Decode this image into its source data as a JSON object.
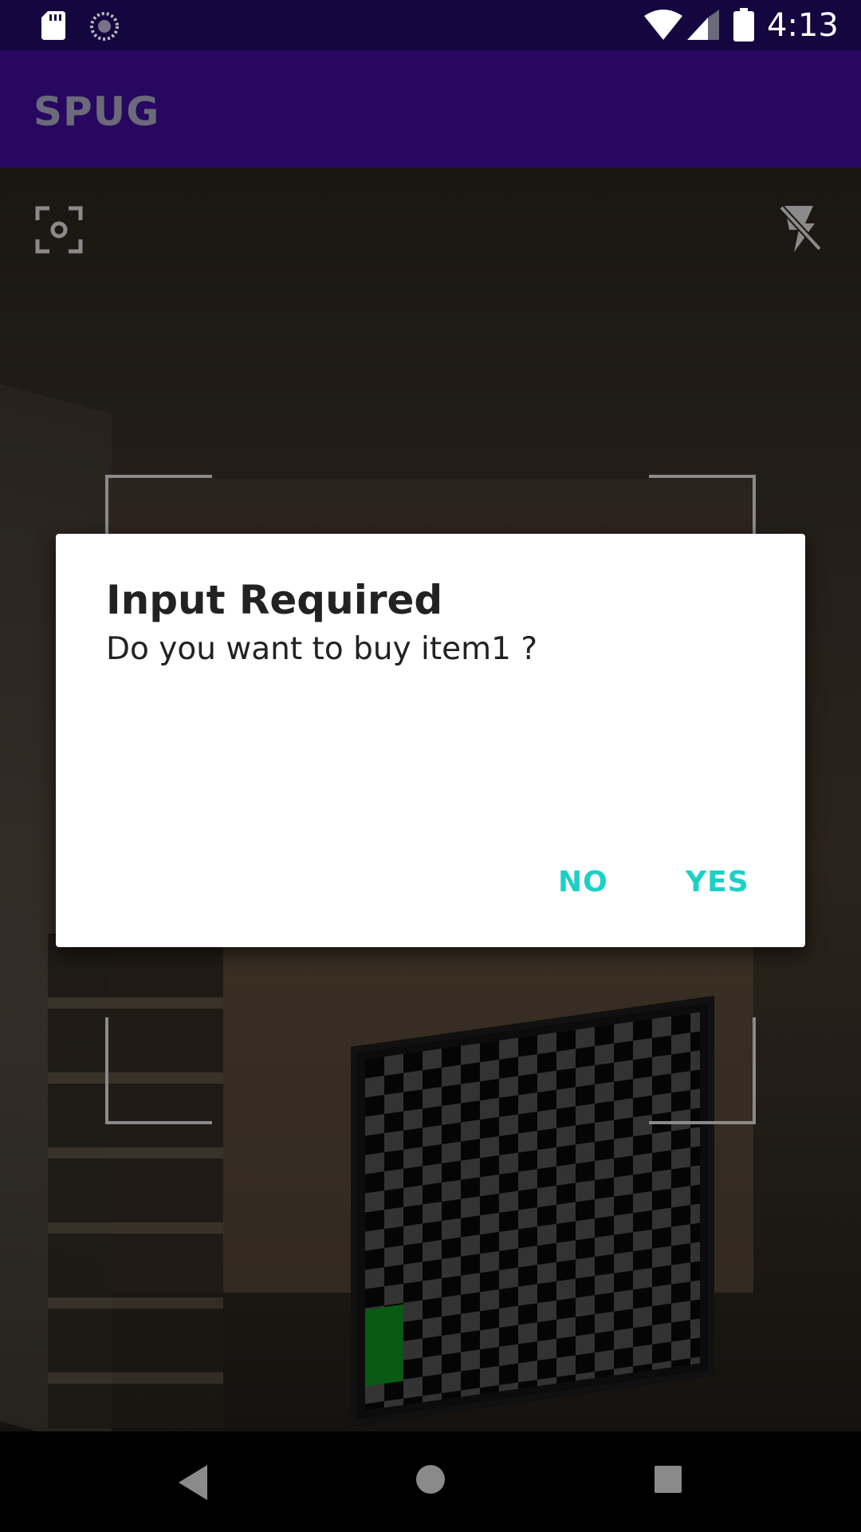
{
  "status_bar": {
    "time": "4:13",
    "icons": [
      "sd-card-icon",
      "sync-icon",
      "wifi-icon",
      "signal-icon",
      "battery-icon"
    ]
  },
  "app_bar": {
    "title": "SPUG"
  },
  "camera": {
    "icons": [
      "camera-switch-icon",
      "flash-off-icon"
    ]
  },
  "dialog": {
    "title": "Input Required",
    "message": "Do you want to buy item1 ?",
    "negative_label": "NO",
    "positive_label": "YES",
    "button_color": "#1bd1c5"
  },
  "nav_bar": {
    "icons": [
      "back-icon",
      "home-icon",
      "recents-icon"
    ]
  },
  "colors": {
    "status_bar": "#150640",
    "app_bar": "#27075f"
  }
}
